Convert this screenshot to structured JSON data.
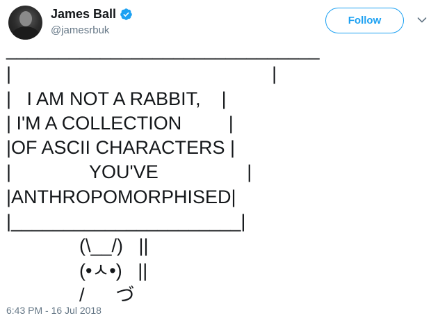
{
  "tweet": {
    "author": {
      "display_name": "James Ball",
      "handle": "@jamesrbuk",
      "verified_icon": "verified-badge-icon",
      "avatar_icon": "user-avatar"
    },
    "follow_label": "Follow",
    "menu_icon": "chevron-down-icon",
    "body_text": "______________________________\n|                                                  |\n|   I AM NOT A RABBIT,    |\n| I'M A COLLECTION         |\n|OF ASCII CHARACTERS |\n|               YOU'VE                 |\n|ANTHROPOMORPHISED|\n|______________________|\n              (\\__/)   ||\n              (•ㅅ•)   ||\n              /      づ",
    "timestamp": "6:43 PM - 16 Jul 2018"
  },
  "colors": {
    "accent": "#1da1f2",
    "text": "#14171a",
    "muted": "#657786"
  }
}
